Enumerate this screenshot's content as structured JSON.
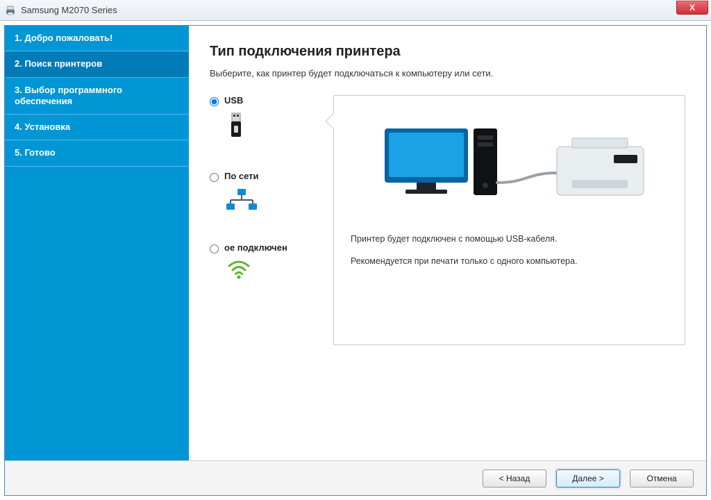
{
  "window": {
    "title": "Samsung M2070 Series",
    "close_glyph": "X"
  },
  "sidebar": {
    "steps": [
      {
        "label": "1. Добро пожаловать!"
      },
      {
        "label": "2. Поиск принтеров",
        "current": true
      },
      {
        "label": "3. Выбор программного обеспечения"
      },
      {
        "label": "4. Установка"
      },
      {
        "label": "5. Готово"
      }
    ]
  },
  "main": {
    "heading": "Тип подключения принтера",
    "subtitle": "Выберите, как принтер будет подключаться к компьютеру или сети.",
    "options": [
      {
        "id": "usb",
        "label": "USB",
        "selected": true
      },
      {
        "id": "network",
        "label": "По сети",
        "selected": false
      },
      {
        "id": "wireless",
        "label": "ое подключен",
        "selected": false
      }
    ],
    "preview": {
      "line1": "Принтер будет подключен с помощью USB-кабеля.",
      "line2": "Рекомендуется при печати только с одного компьютера."
    }
  },
  "buttons": {
    "back": "< Назад",
    "next": "Далее >",
    "cancel": "Отмена"
  }
}
